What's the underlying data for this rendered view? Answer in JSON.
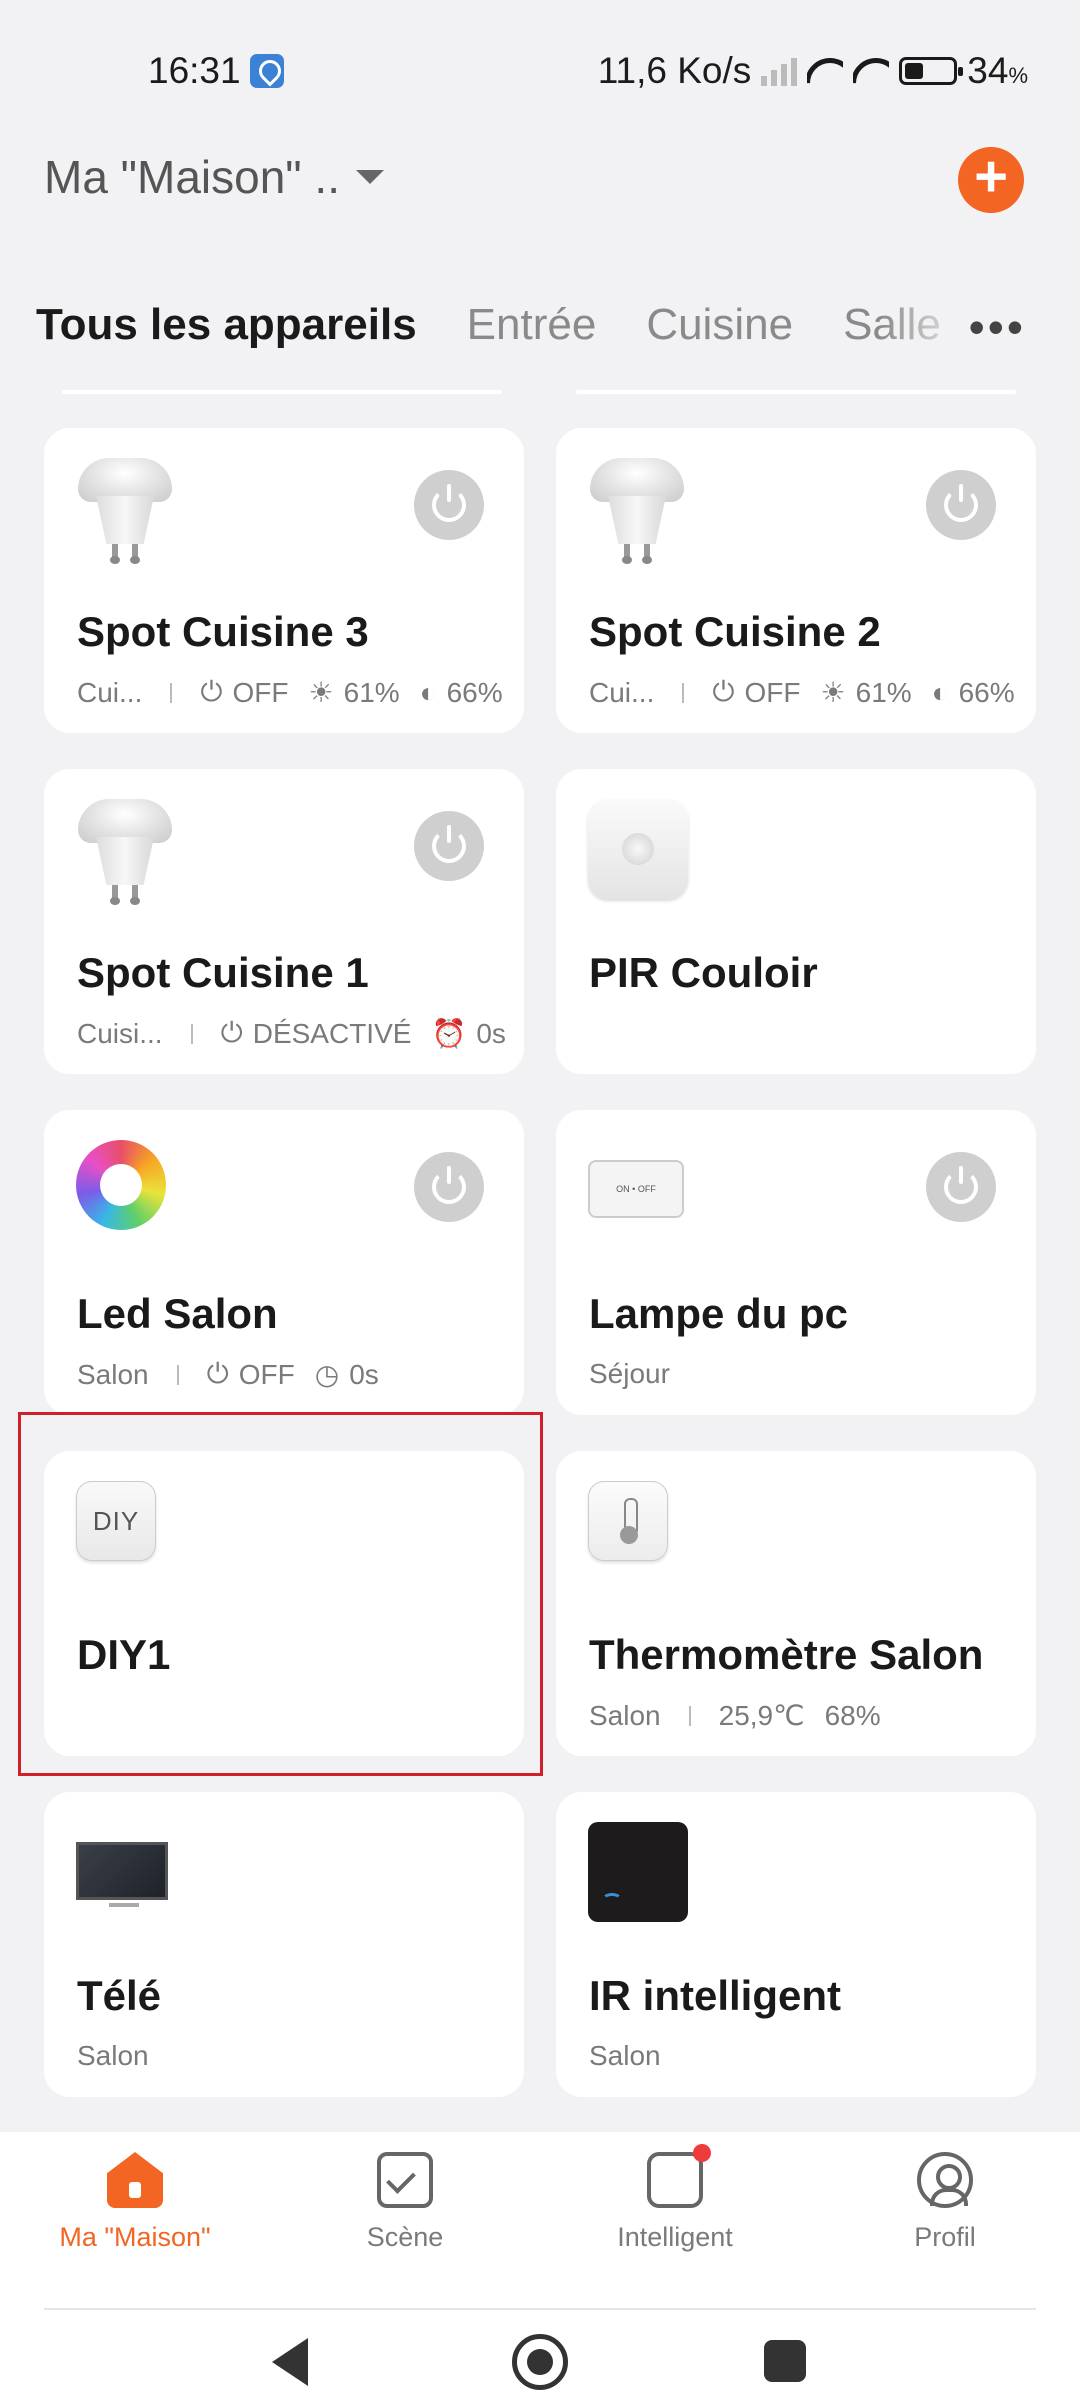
{
  "status_bar": {
    "time": "16:31",
    "network_speed": "11,6 Ko/s",
    "battery": "34",
    "battery_unit": "%"
  },
  "header": {
    "home_title": "Ma \"Maison\" ..",
    "add_label": "+"
  },
  "tabs": [
    "Tous les appareils",
    "Entrée",
    "Cuisine",
    "Salle"
  ],
  "more_label": "•••",
  "devices": [
    {
      "name": "Spot Cuisine 3",
      "room": "Cui...",
      "power": "OFF",
      "brightness": "61%",
      "temp": "66%"
    },
    {
      "name": "Spot Cuisine 2",
      "room": "Cui...",
      "power": "OFF",
      "brightness": "61%",
      "temp": "66%"
    },
    {
      "name": "Spot Cuisine 1",
      "room": "Cuisi...",
      "status": "DÉSACTIVÉ",
      "timer": "0s"
    },
    {
      "name": "PIR Couloir"
    },
    {
      "name": "Led Salon",
      "room": "Salon",
      "power": "OFF",
      "timer": "0s"
    },
    {
      "name": "Lampe du pc",
      "room": "Séjour",
      "icon_text": "ON • OFF"
    },
    {
      "name": "DIY1",
      "icon_text": "DIY"
    },
    {
      "name": "Thermomètre Salon",
      "room": "Salon",
      "temperature": "25,9℃",
      "humidity": "68%"
    },
    {
      "name": "Télé",
      "room": "Salon"
    },
    {
      "name": "IR intelligent",
      "room": "Salon"
    }
  ],
  "bottom_nav": [
    {
      "label": "Ma \"Maison\"",
      "icon": "home-icon",
      "active": true
    },
    {
      "label": "Scène",
      "icon": "scene-check-icon"
    },
    {
      "label": "Intelligent",
      "icon": "smart-cube-icon"
    },
    {
      "label": "Profil",
      "icon": "profile-icon"
    }
  ],
  "colors": {
    "accent": "#f26522",
    "background": "#f2f2f4",
    "card": "#ffffff",
    "highlight": "#d0202a"
  }
}
